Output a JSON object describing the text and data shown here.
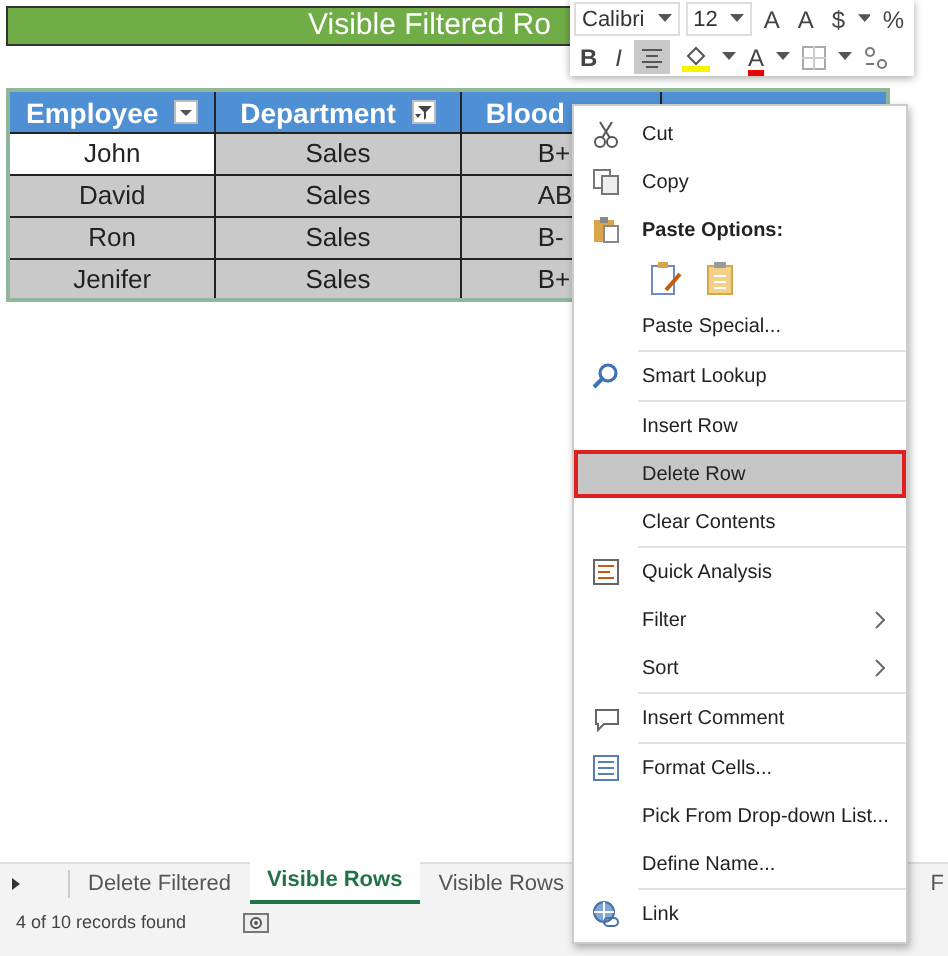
{
  "title": "Visible Filtered Ro",
  "table": {
    "columns": [
      {
        "label": "Employee",
        "kind": "dropdown"
      },
      {
        "label": "Department",
        "kind": "filtered"
      },
      {
        "label": "Blood",
        "kind": "plain"
      }
    ],
    "rows": [
      {
        "cells": [
          "John",
          "Sales",
          "B+"
        ],
        "active": true
      },
      {
        "cells": [
          "David",
          "Sales",
          "AB"
        ],
        "active": false
      },
      {
        "cells": [
          "Ron",
          "Sales",
          "B-"
        ],
        "active": false
      },
      {
        "cells": [
          "Jenifer",
          "Sales",
          "B+"
        ],
        "active": false
      }
    ]
  },
  "mini_toolbar": {
    "font": "Calibri",
    "size": "12",
    "row1": [
      "A",
      "A",
      "$",
      "%"
    ],
    "row2": [
      {
        "label": "B",
        "kind": "bold",
        "selected": false
      },
      {
        "label": "I",
        "kind": "italic",
        "selected": false
      },
      {
        "kind": "align",
        "selected": true
      },
      {
        "kind": "fill",
        "selected": false
      },
      {
        "label": "A",
        "kind": "font-color",
        "selected": false
      },
      {
        "kind": "borders",
        "selected": false
      },
      {
        "kind": "decimal",
        "selected": false
      }
    ]
  },
  "context_menu": [
    {
      "label": "Cut",
      "kind": "action",
      "selected": false,
      "separator_above": false
    },
    {
      "label": "Copy",
      "kind": "action",
      "selected": false,
      "separator_above": false
    },
    {
      "label": "Paste Options:",
      "kind": "header",
      "selected": false,
      "separator_above": false
    },
    {
      "kind": "paste-icons",
      "selected": false,
      "separator_above": false
    },
    {
      "label": "Paste Special...",
      "kind": "action",
      "selected": false,
      "separator_above": false
    },
    {
      "label": "Smart Lookup",
      "kind": "action",
      "selected": false,
      "separator_above": true
    },
    {
      "label": "Insert Row",
      "kind": "action",
      "selected": false,
      "separator_above": true
    },
    {
      "label": "Delete Row",
      "kind": "action",
      "selected": true,
      "separator_above": false
    },
    {
      "label": "Clear Contents",
      "kind": "action",
      "selected": false,
      "separator_above": false
    },
    {
      "label": "Quick Analysis",
      "kind": "action",
      "selected": false,
      "separator_above": true
    },
    {
      "label": "Filter",
      "kind": "submenu",
      "selected": false,
      "separator_above": false
    },
    {
      "label": "Sort",
      "kind": "submenu",
      "selected": false,
      "separator_above": false
    },
    {
      "label": "Insert Comment",
      "kind": "action",
      "selected": false,
      "separator_above": true
    },
    {
      "label": "Format Cells...",
      "kind": "action",
      "selected": false,
      "separator_above": true
    },
    {
      "label": "Pick From Drop-down List...",
      "kind": "action",
      "selected": false,
      "separator_above": false
    },
    {
      "label": "Define Name...",
      "kind": "action",
      "selected": false,
      "separator_above": false
    },
    {
      "label": "Link",
      "kind": "action",
      "selected": false,
      "separator_above": true
    }
  ],
  "sheet_tabs": [
    {
      "label": "Delete Filtered",
      "selected": false
    },
    {
      "label": "Visible Rows",
      "selected": true
    },
    {
      "label": "Visible Rows",
      "selected": false
    },
    {
      "label": "F",
      "selected": false
    }
  ],
  "status_bar": {
    "text": "4 of 10 records found"
  }
}
